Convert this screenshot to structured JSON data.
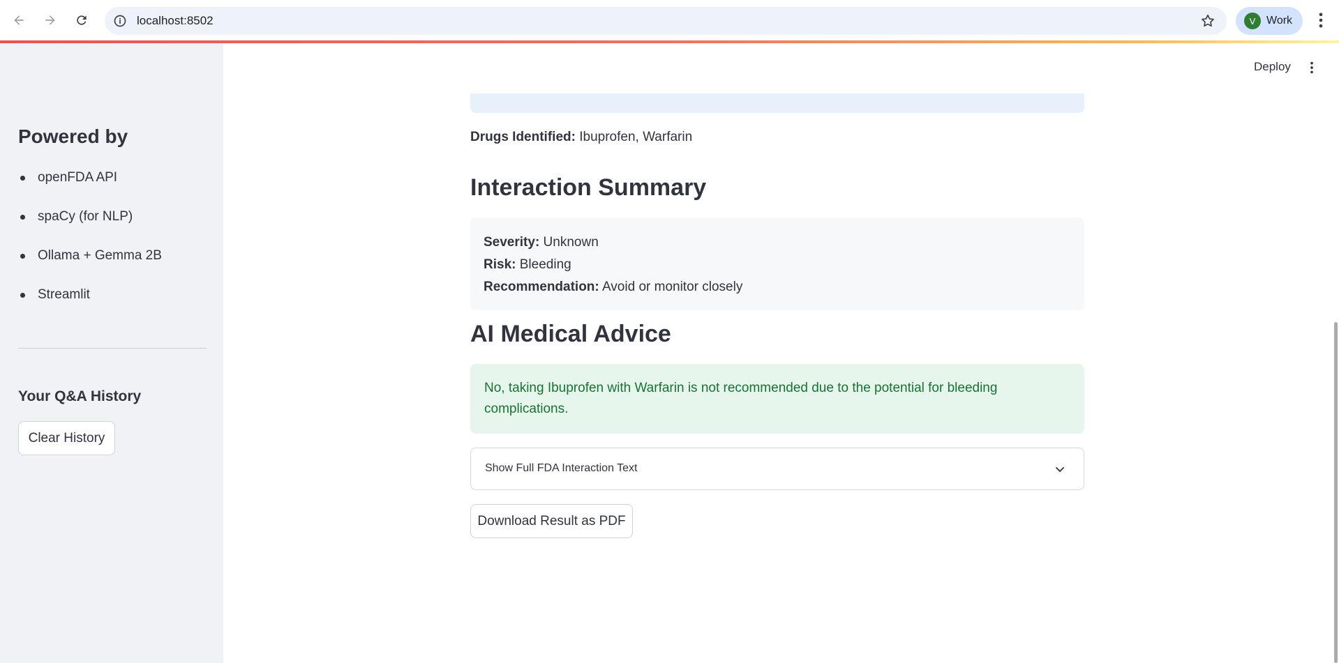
{
  "browser": {
    "url": "localhost:8502",
    "profile_initial": "V",
    "profile_label": "Work"
  },
  "header": {
    "deploy_label": "Deploy"
  },
  "sidebar": {
    "powered_by_title": "Powered by",
    "items": [
      {
        "label": "openFDA API"
      },
      {
        "label": "spaCy (for NLP)"
      },
      {
        "label": "Ollama + Gemma 2B"
      },
      {
        "label": "Streamlit"
      }
    ],
    "history_title": "Your Q&A History",
    "clear_button": "Clear History"
  },
  "main": {
    "drugs_label": "Drugs Identified:",
    "drugs_value": " Ibuprofen, Warfarin",
    "summary_title": "Interaction Summary",
    "summary": {
      "severity_label": "Severity:",
      "severity_value": " Unknown",
      "risk_label": "Risk:",
      "risk_value": " Bleeding",
      "recommendation_label": "Recommendation:",
      "recommendation_value": " Avoid or monitor closely"
    },
    "advice_title": "AI Medical Advice",
    "advice_text": "No, taking Ibuprofen with Warfarin is not recommended due to the potential for bleeding complications.",
    "expander_label": "Show Full FDA Interaction Text",
    "download_button": "Download Result as PDF"
  },
  "colors": {
    "sidebar_bg": "#f0f2f6",
    "success_bg": "#e7f6ec",
    "success_text": "#177233",
    "info_bg": "#e8f0fb",
    "accent": "#ff4b4b"
  }
}
